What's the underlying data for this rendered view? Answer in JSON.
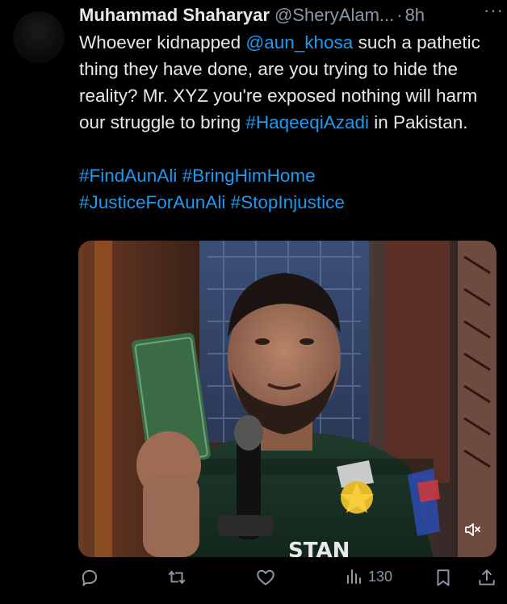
{
  "author": {
    "name": "Muhammad Shaharyar",
    "handle": "@SheryAlam...",
    "separator": "·",
    "time": "8h",
    "more_label": "···"
  },
  "tweet": {
    "text_1": "Whoever kidnapped ",
    "mention": "@aun_khosa",
    "text_2": " such a pathetic thing they have done, are you trying to hide the reality? Mr. XYZ you're exposed nothing will harm our struggle to bring ",
    "hashtag_inline": "#HaqeeqiAzadi",
    "text_3": " in Pakistan.",
    "hashtags": [
      "#FindAunAli",
      "#BringHimHome",
      "#JusticeForAunAli",
      "#StopInjustice"
    ]
  },
  "media": {
    "type": "video",
    "mute_icon": "speaker-muted-icon"
  },
  "actions": {
    "reply_icon": "reply-icon",
    "retweet_icon": "retweet-icon",
    "like_icon": "heart-icon",
    "views_icon": "views-icon",
    "views_count": "130",
    "bookmark_icon": "bookmark-icon",
    "share_icon": "share-icon"
  },
  "colors": {
    "background": "#000000",
    "text": "#e7e9ea",
    "secondary": "#8b98a5",
    "link": "#1d9bf0"
  }
}
